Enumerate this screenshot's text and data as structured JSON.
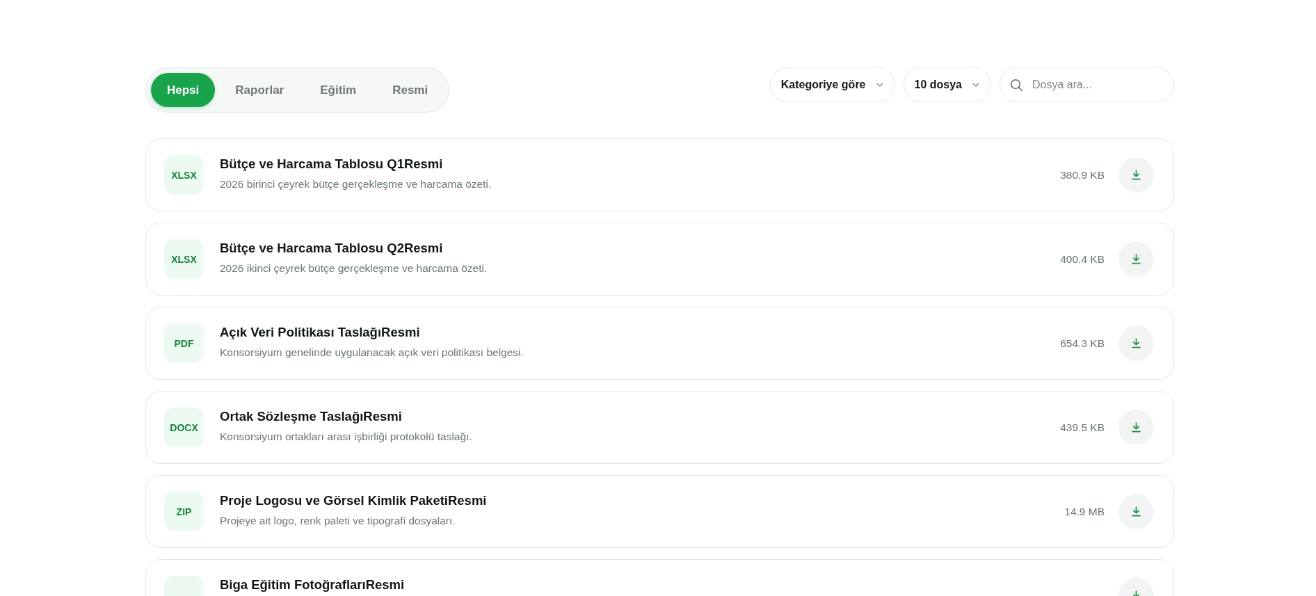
{
  "filter_tabs": [
    {
      "label": "Hepsi",
      "selected": true
    },
    {
      "label": "Raporlar",
      "selected": false
    },
    {
      "label": "Eğitim",
      "selected": false
    },
    {
      "label": "Resmi",
      "selected": false
    }
  ],
  "toolbar": {
    "category_dropdown": {
      "label": "Kategoriye göre"
    },
    "count_dropdown": {
      "label": "10 dosya"
    },
    "search": {
      "placeholder": "Dosya ara..."
    }
  },
  "files": [
    {
      "format": "XLSX",
      "title": "Bütçe ve Harcama Tablosu Q1Resmi",
      "description": "2026 birinci çeyrek bütçe gerçekleşme ve harcama özeti.",
      "size": "380.9 KB"
    },
    {
      "format": "XLSX",
      "title": "Bütçe ve Harcama Tablosu Q2Resmi",
      "description": "2026 ikinci çeyrek bütçe gerçekleşme ve harcama özeti.",
      "size": "400.4 KB"
    },
    {
      "format": "PDF",
      "title": "Açık Veri Politikası TaslağıResmi",
      "description": "Konsorsiyum genelinde uygulanacak açık veri politikası belgesi.",
      "size": "654.3 KB"
    },
    {
      "format": "DOCX",
      "title": "Ortak Sözleşme TaslağıResmi",
      "description": "Konsorsiyum ortakları arası işbirliği protokolü taslağı.",
      "size": "439.5 KB"
    },
    {
      "format": "ZIP",
      "title": "Proje Logosu ve Görsel Kimlik PaketiResmi",
      "description": "Projeye ait logo, renk paleti ve tipografi dosyaları.",
      "size": "14.9 MB"
    },
    {
      "title": "Biga Eğitim FotoğraflarıResmi"
    }
  ]
}
